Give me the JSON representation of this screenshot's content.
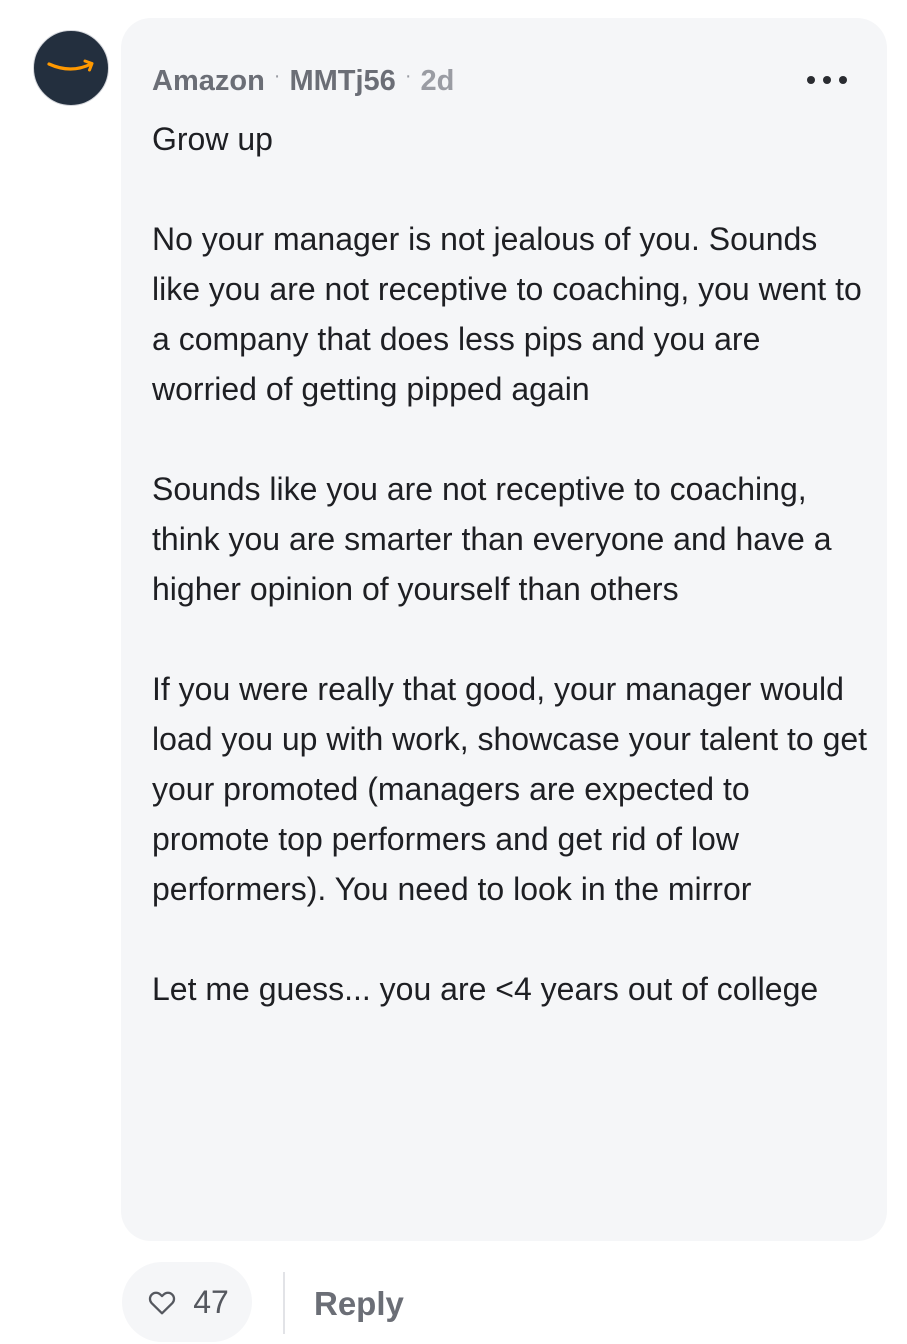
{
  "post": {
    "avatar_icon": "amazon-smile-icon",
    "company": "Amazon",
    "separator": "·",
    "username": "MMTj56",
    "time": "2d",
    "more_icon": "more-horizontal-icon",
    "paragraphs": [
      "Grow up",
      "No your manager is not jealous of you. Sounds like you are not receptive to coaching, you went to a company that does less pips and you are worried of getting pipped again",
      "Sounds like you are not receptive to coaching, think you are smarter than everyone and have a higher opinion of yourself than others",
      "If you were really that good, your manager would load you up with work, showcase your talent to get your promoted (managers are expected to promote top performers and get rid of low performers). You need to look in the mirror",
      "Let me guess... you are <4 years out of college"
    ]
  },
  "actions": {
    "like_icon": "heart-outline-icon",
    "like_count": "47",
    "reply_label": "Reply"
  },
  "colors": {
    "bubble_bg": "#f5f6f8",
    "avatar_bg": "#232f3e",
    "amazon_orange": "#ff9900",
    "meta_text": "#6b6e76"
  }
}
